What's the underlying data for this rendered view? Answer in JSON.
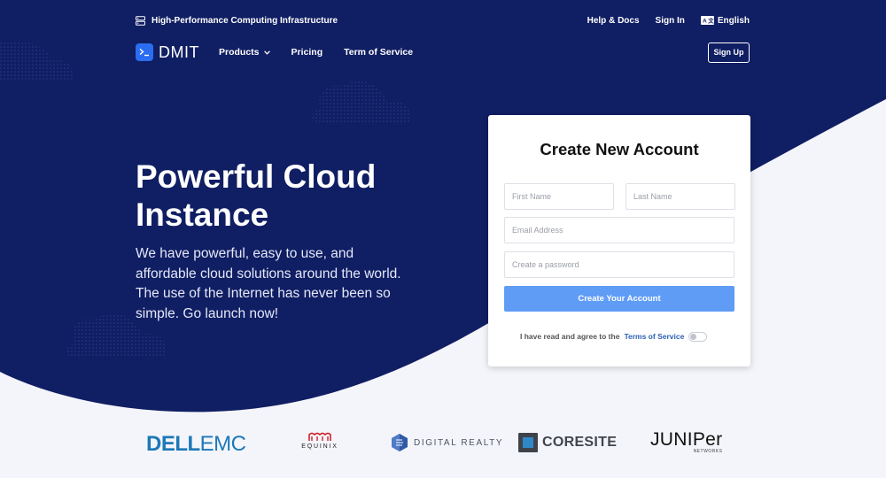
{
  "colors": {
    "hero_bg": "#101e63",
    "accent": "#2b6df0",
    "button": "#5f9cf6",
    "link": "#2c5eb4"
  },
  "topbar": {
    "tagline_icon": "server-icon",
    "tagline": "High-Performance Computing Infrastructure",
    "help": "Help & Docs",
    "signin": "Sign In",
    "lang_icon": "translate-icon",
    "language": "English"
  },
  "nav": {
    "logo": "DMIT",
    "logo_icon": "terminal-icon",
    "products": "Products",
    "pricing": "Pricing",
    "terms": "Term of Service",
    "signup": "Sign Up"
  },
  "hero": {
    "title_line1": "Powerful Cloud",
    "title_line2": "Instance",
    "subtitle": "We have powerful, easy to use, and affordable cloud solutions around the world. The use of the Internet has never been so simple. Go launch now!"
  },
  "form": {
    "title": "Create New Account",
    "first_name_placeholder": "First Name",
    "last_name_placeholder": "Last Name",
    "email_placeholder": "Email Address",
    "password_placeholder": "Create a password",
    "submit": "Create Your Account",
    "agree_text": "I have read and agree to the",
    "agree_link": "Terms of Service",
    "agree_checked": false
  },
  "partners": {
    "dell_a": "DELL",
    "dell_b": "EMC",
    "equinix": "EQUINIX",
    "digital_realty": "DIGITAL REALTY",
    "coresite": "CORESITE",
    "juniper": "JUNIPer",
    "juniper_sub": "NETWORKS"
  }
}
